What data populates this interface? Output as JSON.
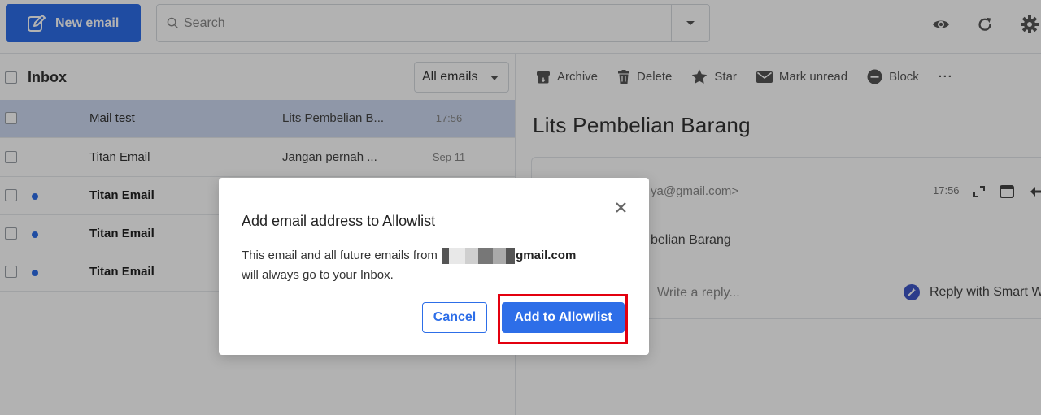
{
  "toolbar": {
    "new_email_label": "New email",
    "search_placeholder": "Search"
  },
  "inbox": {
    "title": "Inbox",
    "filter_label": "All emails",
    "rows": [
      {
        "from": "Mail test",
        "subject": "Lits Pembelian B...",
        "time": "17:56",
        "unread": false,
        "selected": true
      },
      {
        "from": "Titan Email",
        "subject": "Jangan pernah ...",
        "time": "Sep 11",
        "unread": false,
        "selected": false
      },
      {
        "from": "Titan Email",
        "subject": "",
        "time": "",
        "unread": true,
        "selected": false
      },
      {
        "from": "Titan Email",
        "subject": "",
        "time": "",
        "unread": true,
        "selected": false
      },
      {
        "from": "Titan Email",
        "subject": "",
        "time": "",
        "unread": true,
        "selected": false
      }
    ]
  },
  "reading_pane": {
    "actions": {
      "archive": "Archive",
      "delete": "Delete",
      "star": "Star",
      "mark_unread": "Mark unread",
      "block": "Block",
      "more": "···"
    },
    "subject": "Lits Pembelian Barang",
    "message": {
      "from_partial": "ya@gmail.com>",
      "time": "17:56",
      "subject_partial": "belian Barang"
    },
    "reply_placeholder": "Write a reply...",
    "smart_reply_label": "Reply with Smart W"
  },
  "dialog": {
    "title": "Add email address to Allowlist",
    "body_prefix": "This email and all future emails from",
    "email_suffix": "gmail.com",
    "body_suffix": "will always go to your Inbox.",
    "cancel_label": "Cancel",
    "confirm_label": "Add to Allowlist",
    "highlight_color": "#e3000f"
  },
  "colors": {
    "accent": "#2d6ee8",
    "selected_row": "#cdd9f1"
  }
}
